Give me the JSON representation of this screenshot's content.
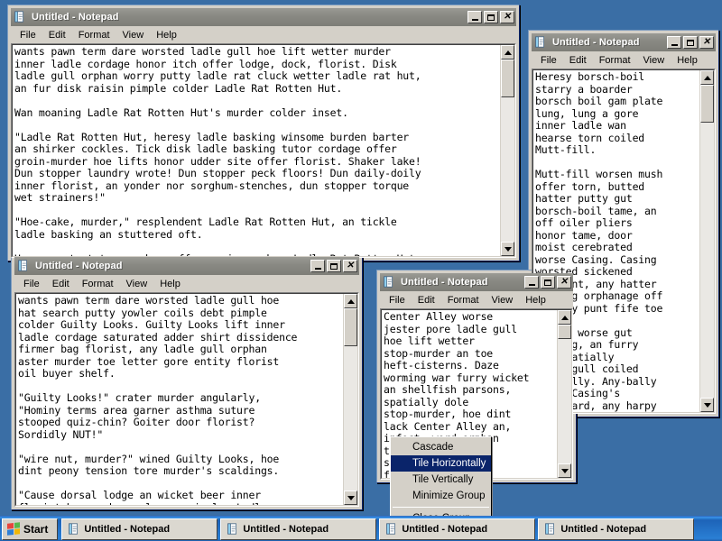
{
  "desktop": {
    "background_color": "#3a6ea5"
  },
  "windows": [
    {
      "id": "window-1",
      "title": "Untitled - Notepad",
      "icon": "notepad-icon",
      "active": false,
      "menu": [
        "File",
        "Edit",
        "Format",
        "View",
        "Help"
      ],
      "text": "wants pawn term dare worsted ladle gull hoe lift wetter murder\ninner ladle cordage honor itch offer lodge, dock, florist. Disk\nladle gull orphan worry putty ladle rat cluck wetter ladle rat hut,\nan fur disk raisin pimple colder Ladle Rat Rotten Hut.\n\nWan moaning Ladle Rat Rotten Hut's murder colder inset.\n\n\"Ladle Rat Rotten Hut, heresy ladle basking winsome burden barter\nan shirker cockles. Tick disk ladle basking tutor cordage offer\ngroin-murder hoe lifts honor udder site offer florist. Shaker lake!\nDun stopper laundry wrote! Dun stopper peck floors! Dun daily-doily\ninner florist, an yonder nor sorghum-stenches, dun stopper torque\nwet strainers!\"\n\n\"Hoe-cake, murder,\" resplendent Ladle Rat Rotten Hut, an tickle\nladle basking an stuttered oft.\n\nHonor wrote tutor cordage offer groin-murder, Ladle Rat Rotten Hut"
    },
    {
      "id": "window-2",
      "title": "Untitled - Notepad",
      "icon": "notepad-icon",
      "active": false,
      "menu": [
        "File",
        "Edit",
        "Format",
        "View",
        "Help"
      ],
      "text": "Heresy borsch-boil\nstarry a boarder\nborsch boil gam plate\nlung, lung a gore\ninner ladle wan\nhearse torn coiled\nMutt-fill.\n\nMutt-fill worsen mush\noffer torn, butted\nhatter putty gut\nborsch-boil tame, an\noff oiler pliers\nhonor tame, door\nmoist cerebrated\nworse Casing. Casing\nworsted sickened\nbassment, any hatter\nbetting orphanage off\nfortify punt fife toe\n\nCasing worse gut\nbedding, an furry\ngut-spatially\nladle gull coiled\nAny-bally. Any-bally\nworse Casing's\nbest hard, any harpy"
    },
    {
      "id": "window-3",
      "title": "Untitled - Notepad",
      "icon": "notepad-icon",
      "active": false,
      "menu": [
        "File",
        "Edit",
        "Format",
        "View",
        "Help"
      ],
      "text": "wants pawn term dare worsted ladle gull hoe\nhat search putty yowler coils debt pimple\ncolder Guilty Looks. Guilty Looks lift inner\nladle cordage saturated adder shirt dissidence\nfirmer bag florist, any ladle gull orphan\naster murder toe letter gore entity florist\noil buyer shelf.\n\n\"Guilty Looks!\" crater murder angularly,\n\"Hominy terms area garner asthma suture\nstooped quiz-chin? Goiter door florist?\nSordidly NUT!\"\n\n\"wire nut, murder?\" wined Guilty Looks, hoe\ndint peony tension tore murder's scaldings.\n\n\"Cause dorsal lodge an wicket beer inner\nflorist hoe orphan molasses pimple. Ladle"
    },
    {
      "id": "window-4",
      "title": "Untitled - Notepad",
      "icon": "notepad-icon",
      "active": false,
      "menu": [
        "File",
        "Edit",
        "Format",
        "View",
        "Help"
      ],
      "text": "Center Alley worse\njester pore ladle gull\nhoe lift wetter\nstop-murder an toe\nheft-cisterns. Daze\nworming war furry wicket\nan shellfish parsons,\nspatially dole\nstop-murder, hoe dint\nlack Center Alley an,\ninfect, word orphan\ntelltale mar\nshudder inner\nfoully inner"
    }
  ],
  "titlebar_buttons": {
    "minimize": "minimize-button",
    "maximize": "maximize-button",
    "close": "close-button"
  },
  "context_menu": {
    "items": [
      {
        "label": "Cascade",
        "selected": false,
        "separator_after": false
      },
      {
        "label": "Tile Horizontally",
        "selected": true,
        "separator_after": false
      },
      {
        "label": "Tile Vertically",
        "selected": false,
        "separator_after": false
      },
      {
        "label": "Minimize Group",
        "selected": false,
        "separator_after": true
      },
      {
        "label": "Close Group",
        "selected": false,
        "separator_after": false
      }
    ],
    "highlight_color": "#0a246a"
  },
  "taskbar": {
    "start_label": "Start",
    "buttons": [
      {
        "label": "Untitled - Notepad",
        "icon": "notepad-icon"
      },
      {
        "label": "Untitled - Notepad",
        "icon": "notepad-icon"
      },
      {
        "label": "Untitled - Notepad",
        "icon": "notepad-icon"
      },
      {
        "label": "Untitled - Notepad",
        "icon": "notepad-icon"
      }
    ]
  }
}
